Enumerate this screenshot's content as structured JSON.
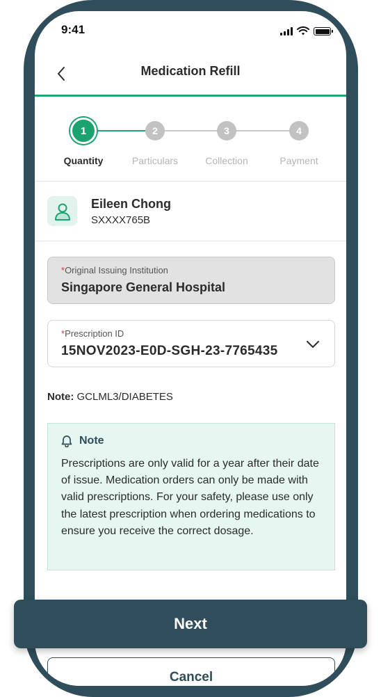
{
  "status_bar": {
    "time": "9:41"
  },
  "header": {
    "title": "Medication Refill"
  },
  "stepper": {
    "current_step": 1,
    "steps": [
      {
        "number": "1",
        "label": "Quantity"
      },
      {
        "number": "2",
        "label": "Particulars"
      },
      {
        "number": "3",
        "label": "Collection"
      },
      {
        "number": "4",
        "label": "Payment"
      }
    ]
  },
  "patient": {
    "name": "Eileen Chong",
    "id": "SXXXX765B"
  },
  "form": {
    "required_mark": "*",
    "institution": {
      "label": "Original Issuing Institution",
      "value": "Singapore General Hospital"
    },
    "prescription": {
      "label": "Prescription ID",
      "value": "15NOV2023-E0D-SGH-23-7765435"
    }
  },
  "note_line": {
    "label": "Note:",
    "value": "GCLML3/DIABETES"
  },
  "note_box": {
    "title": "Note",
    "body": "Prescriptions are only valid for a year after their date of issue. Medication orders can only be made with valid prescriptions. For your safety, please use only the latest prescription when ordering medications to ensure you receive the correct dosage."
  },
  "buttons": {
    "next": "Next",
    "cancel": "Cancel"
  },
  "colors": {
    "primary_dark": "#2f4d5a",
    "accent_green": "#1aa36f",
    "note_background": "#e6f6f0",
    "required": "#d23b3b"
  },
  "icons": {
    "back": "chevron-left-icon",
    "avatar": "user-icon",
    "dropdown": "chevron-down-icon",
    "note": "bell-icon"
  }
}
